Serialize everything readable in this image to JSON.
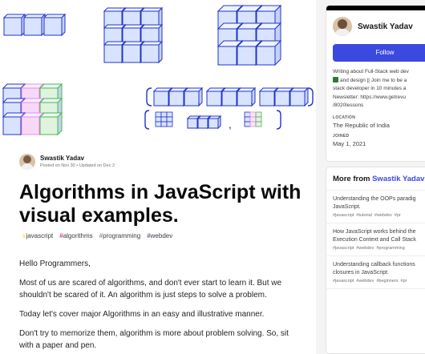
{
  "article": {
    "author": "Swastik Yadav",
    "date": "Posted on Nov 30 • Updated on Dec 2",
    "title": "Algorithms in JavaScript with visual examples.",
    "tags": [
      "javascript",
      "algorithms",
      "programming",
      "webdev"
    ],
    "paragraphs": [
      "Hello Programmers,",
      "Most of us are scared of algorithms, and don't ever start to learn it. But we shouldn't be scared of it. An algorithm is just steps to solve a problem.",
      "Today let's cover major Algorithms in an easy and illustrative manner.",
      "Don't try to memorize them, algorithm is more about problem solving. So, sit with a paper and pen."
    ],
    "cover_punctuation": ",",
    "colors": {
      "cube_fill": "#d8e4ff",
      "cube_stroke": "#2233cc",
      "highlight_pink": "#ee88ee",
      "highlight_green": "#44bb44"
    }
  },
  "sidebar": {
    "name": "Swastik Yadav",
    "follow_label": "Follow",
    "bio_lines": [
      "Writing about Full-Stack web dev",
      "and design || Join me to be a",
      "stack developer in 10 minutes a",
      "Newsletter: https://www.getrevu",
      "/8020lessons"
    ],
    "location_label": "LOCATION",
    "location": "The Republic of India",
    "joined_label": "JOINED",
    "joined": "May 1, 2021"
  },
  "more_from": {
    "prefix": "More from",
    "author": "Swastik Yadav",
    "items": [
      {
        "lines": [
          "Understanding the OOPs paradig",
          "JavaScript."
        ],
        "tags": [
          "#javascript",
          "#tutorial",
          "#webdev",
          "#pr"
        ]
      },
      {
        "lines": [
          "How JavaScript works behind the",
          "Execution Context and Call Stack"
        ],
        "tags": [
          "#javascript",
          "#webdev",
          "#programming"
        ]
      },
      {
        "lines": [
          "Understanding callback functions",
          "closures in JavaScript."
        ],
        "tags": [
          "#javascript",
          "#webdev",
          "#beginners",
          "#pr"
        ]
      }
    ]
  }
}
